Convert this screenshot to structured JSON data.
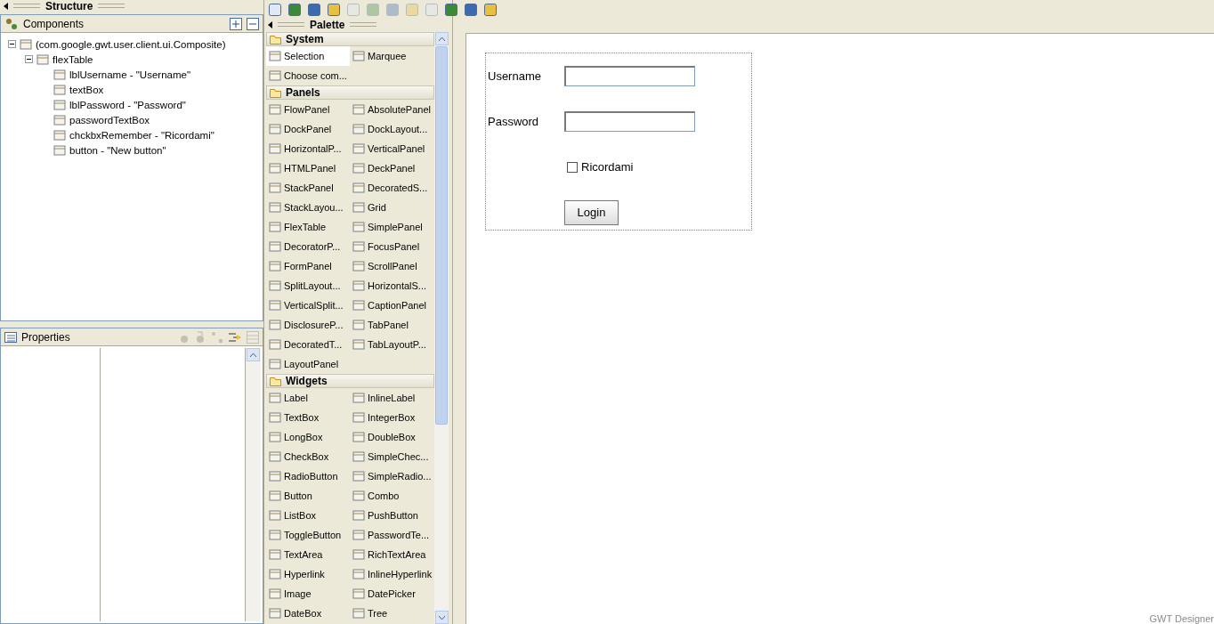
{
  "structure": {
    "title": "Structure",
    "components_title": "Components",
    "tree": [
      {
        "label": "(com.google.gwt.user.client.ui.Composite)",
        "expanded": true,
        "children": [
          {
            "label": "flexTable",
            "expanded": true,
            "children": [
              {
                "label": "lblUsername - \"Username\""
              },
              {
                "label": "textBox"
              },
              {
                "label": "lblPassword - \"Password\""
              },
              {
                "label": "passwordTextBox"
              },
              {
                "label": "chckbxRemember - \"Ricordami\""
              },
              {
                "label": "button - \"New button\""
              }
            ]
          }
        ]
      }
    ]
  },
  "properties": {
    "title": "Properties"
  },
  "toolbar": [
    {
      "disabled": false
    },
    {
      "disabled": false
    },
    {
      "disabled": false
    },
    {
      "disabled": false
    },
    {
      "disabled": true
    },
    {
      "disabled": true
    },
    {
      "disabled": true
    },
    {
      "disabled": true
    },
    {
      "disabled": true
    },
    {
      "disabled": false
    },
    {
      "disabled": false
    },
    {
      "disabled": false
    }
  ],
  "palette": {
    "title": "Palette",
    "categories": [
      {
        "name": "System",
        "items": [
          {
            "label": "Selection",
            "selected": true
          },
          {
            "label": "Marquee",
            "selected": false
          },
          {
            "label": "Choose com...",
            "selected": false
          }
        ]
      },
      {
        "name": "Panels",
        "items": [
          {
            "label": "FlowPanel",
            "selected": false
          },
          {
            "label": "AbsolutePanel",
            "selected": false
          },
          {
            "label": "DockPanel",
            "selected": false
          },
          {
            "label": "DockLayout...",
            "selected": false
          },
          {
            "label": "HorizontalP...",
            "selected": false
          },
          {
            "label": "VerticalPanel",
            "selected": false
          },
          {
            "label": "HTMLPanel",
            "selected": false
          },
          {
            "label": "DeckPanel",
            "selected": false
          },
          {
            "label": "StackPanel",
            "selected": false
          },
          {
            "label": "DecoratedS...",
            "selected": false
          },
          {
            "label": "StackLayou...",
            "selected": false
          },
          {
            "label": "Grid",
            "selected": false
          },
          {
            "label": "FlexTable",
            "selected": false
          },
          {
            "label": "SimplePanel",
            "selected": false
          },
          {
            "label": "DecoratorP...",
            "selected": false
          },
          {
            "label": "FocusPanel",
            "selected": false
          },
          {
            "label": "FormPanel",
            "selected": false
          },
          {
            "label": "ScrollPanel",
            "selected": false
          },
          {
            "label": "SplitLayout...",
            "selected": false
          },
          {
            "label": "HorizontalS...",
            "selected": false
          },
          {
            "label": "VerticalSplit...",
            "selected": false
          },
          {
            "label": "CaptionPanel",
            "selected": false
          },
          {
            "label": "DisclosureP...",
            "selected": false
          },
          {
            "label": "TabPanel",
            "selected": false
          },
          {
            "label": "DecoratedT...",
            "selected": false
          },
          {
            "label": "TabLayoutP...",
            "selected": false
          },
          {
            "label": "LayoutPanel",
            "selected": false
          }
        ]
      },
      {
        "name": "Widgets",
        "items": [
          {
            "label": "Label",
            "selected": false
          },
          {
            "label": "InlineLabel",
            "selected": false
          },
          {
            "label": "TextBox",
            "selected": false
          },
          {
            "label": "IntegerBox",
            "selected": false
          },
          {
            "label": "LongBox",
            "selected": false
          },
          {
            "label": "DoubleBox",
            "selected": false
          },
          {
            "label": "CheckBox",
            "selected": false
          },
          {
            "label": "SimpleChec...",
            "selected": false
          },
          {
            "label": "RadioButton",
            "selected": false
          },
          {
            "label": "SimpleRadio...",
            "selected": false
          },
          {
            "label": "Button",
            "selected": false
          },
          {
            "label": "Combo",
            "selected": false
          },
          {
            "label": "ListBox",
            "selected": false
          },
          {
            "label": "PushButton",
            "selected": false
          },
          {
            "label": "ToggleButton",
            "selected": false
          },
          {
            "label": "PasswordTe...",
            "selected": false
          },
          {
            "label": "TextArea",
            "selected": false
          },
          {
            "label": "RichTextArea",
            "selected": false
          },
          {
            "label": "Hyperlink",
            "selected": false
          },
          {
            "label": "InlineHyperlink",
            "selected": false
          },
          {
            "label": "Image",
            "selected": false
          },
          {
            "label": "DatePicker",
            "selected": false
          },
          {
            "label": "DateBox",
            "selected": false
          },
          {
            "label": "Tree",
            "selected": false
          }
        ]
      }
    ]
  },
  "form": {
    "username_label": "Username",
    "password_label": "Password",
    "remember": {
      "label": "Ricordami",
      "checked": false
    },
    "login_button": "Login"
  },
  "footer_mark": "GWT Designer"
}
